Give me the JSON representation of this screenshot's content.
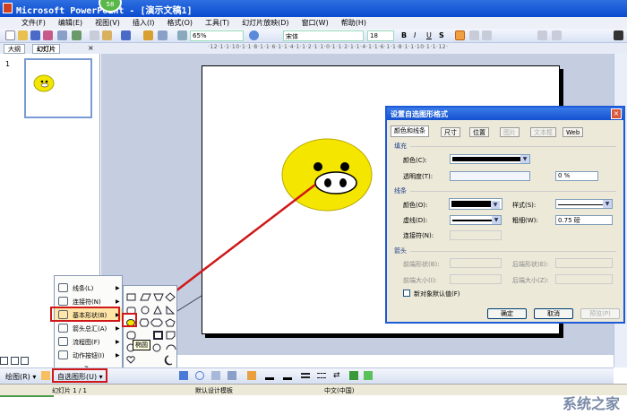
{
  "window": {
    "title": "Microsoft PowerPoint - [演示文稿1]",
    "badge": "58"
  },
  "menubar": [
    "文件(F)",
    "编辑(E)",
    "视图(V)",
    "插入(I)",
    "格式(O)",
    "工具(T)",
    "幻灯片放映(D)",
    "窗口(W)",
    "帮助(H)"
  ],
  "toolbar": {
    "zoom": "65%",
    "font": "宋体",
    "font_size": "18",
    "bold": "B",
    "italic": "I",
    "underline": "U",
    "shadow": "S"
  },
  "pane_tabs": {
    "outline": "大纲",
    "slides": "幻灯片",
    "close": "×"
  },
  "ruler": "·12·1·1·10·1·1·8·1·1·6·1·1·4·1·1·2·1·1·0·1·1·2·1·1·4·1·1·6·1·1·8·1·1·10·1·1·12·",
  "slide_number": "1",
  "dialog": {
    "title": "设置自选图形格式",
    "close": "×",
    "tabs": [
      "颜色和线条",
      "尺寸",
      "位置",
      "图片",
      "文本框",
      "Web"
    ],
    "fill": {
      "group": "填充",
      "color_label": "颜色(C):",
      "fill_color": "#000000",
      "transparency_label": "透明度(T):",
      "transparency_value": "0 %"
    },
    "line": {
      "group": "线条",
      "color_label": "颜色(O):",
      "dash_label": "虚线(D):",
      "connector_label": "连接符(N):",
      "style_label": "样式(S):",
      "weight_label": "粗细(W):",
      "weight_value": "0.75 磅"
    },
    "arrows": {
      "group": "箭头",
      "begin_style": "前端形状(B):",
      "begin_size": "前端大小(I):",
      "end_style": "后端形状(E):",
      "end_size": "后端大小(Z):"
    },
    "default_checkbox": "新对象默认值(F)",
    "ok": "确定",
    "cancel": "取消",
    "preview": "预览(P)"
  },
  "autoshapes_menu": {
    "items": [
      {
        "label": "线条(L)"
      },
      {
        "label": "连接符(N)"
      },
      {
        "label": "基本形状(B)",
        "highlighted": true
      },
      {
        "label": "箭头总汇(A)"
      },
      {
        "label": "流程图(F)"
      },
      {
        "label": "动作按钮(I)"
      }
    ],
    "more": "»"
  },
  "shape_tooltip": "椭圆",
  "drawbar": {
    "draw": "绘图(R) ▾",
    "autoshapes": "自选图形(U) ▾"
  },
  "statusbar": {
    "slide": "幻灯片 1 / 1",
    "template": "默认设计模板",
    "language": "中文(中国)"
  },
  "watermark": "系统之家",
  "colors": {
    "smiley": "#f5e600",
    "highlight": "#d01818",
    "titlebar": "#1450d0"
  }
}
